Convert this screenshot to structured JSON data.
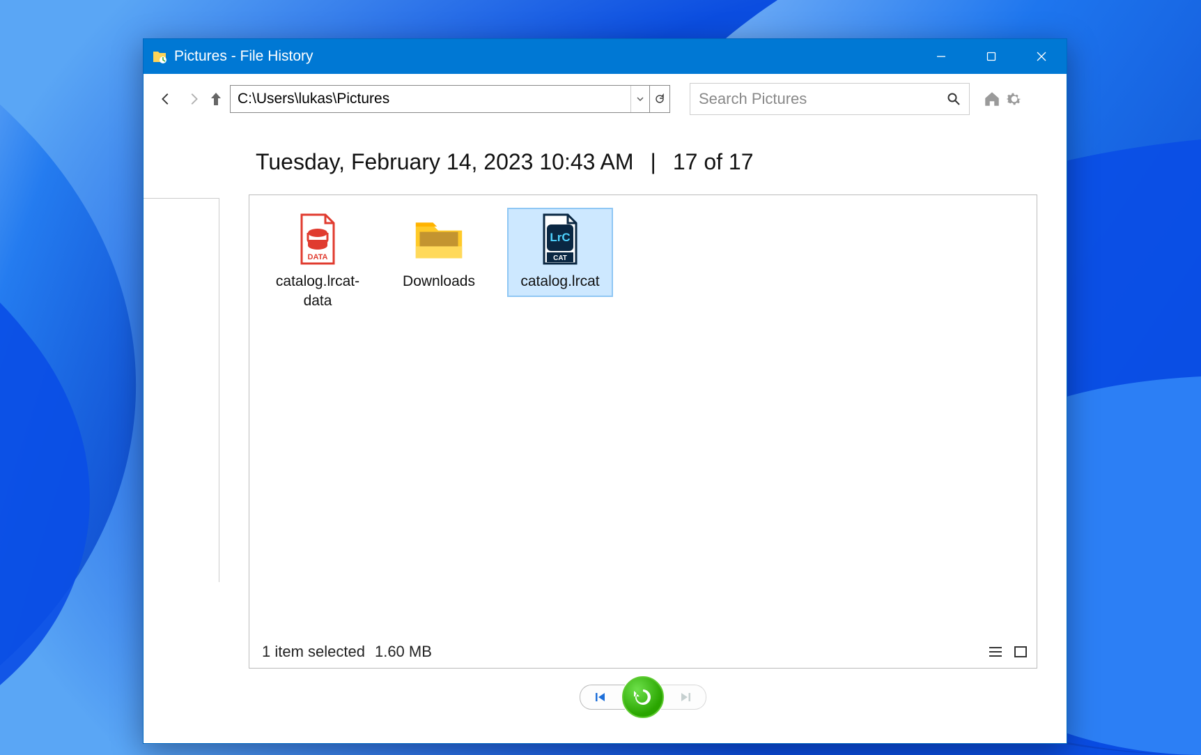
{
  "window": {
    "title": "Pictures - File History",
    "min_label": "Minimize",
    "max_label": "Maximize",
    "close_label": "Close"
  },
  "nav": {
    "back_label": "Back",
    "forward_label": "Forward",
    "up_label": "Up"
  },
  "address": {
    "value": "C:\\Users\\lukas\\Pictures",
    "dropdown_label": "Recent locations",
    "refresh_label": "Refresh"
  },
  "search": {
    "placeholder": "Search Pictures",
    "icon_label": "Search"
  },
  "rightbar": {
    "home_label": "Home",
    "settings_label": "Settings"
  },
  "header": {
    "date_text": "Tuesday, February 14, 2023 10:43 AM",
    "separator": "  |  ",
    "position_text": "17 of 17"
  },
  "items": [
    {
      "name": "catalog.lrcat-data",
      "kind": "data-file",
      "selected": false
    },
    {
      "name": "Downloads",
      "kind": "folder",
      "selected": false
    },
    {
      "name": "catalog.lrcat",
      "kind": "lrc-file",
      "selected": true
    }
  ],
  "status": {
    "selection_text": "1 item selected",
    "size_text": "1.60 MB"
  },
  "view": {
    "details_label": "Details view",
    "icons_label": "Large icons view"
  },
  "footer": {
    "prev_label": "Previous version",
    "restore_label": "Restore",
    "next_label": "Next version"
  }
}
